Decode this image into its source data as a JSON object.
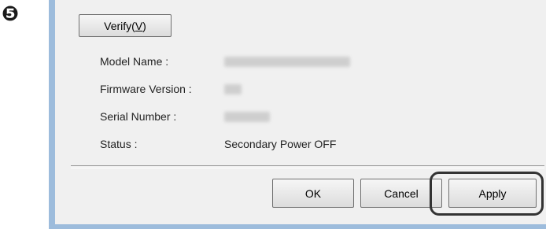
{
  "step_marker": "❺",
  "dialog": {
    "verify_label": "Verify",
    "verify_shortcut": "V",
    "rows": [
      {
        "label": "Model Name :",
        "value": ""
      },
      {
        "label": "Firmware Version :",
        "value": ""
      },
      {
        "label": "Serial Number :",
        "value": ""
      },
      {
        "label": "Status :",
        "value": "Secondary Power OFF"
      }
    ],
    "buttons": {
      "ok": "OK",
      "cancel": "Cancel",
      "apply": "Apply"
    }
  }
}
